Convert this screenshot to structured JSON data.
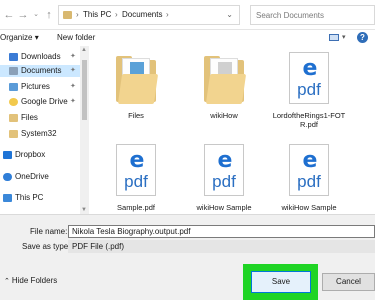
{
  "address_bar": {
    "breadcrumbs": [
      "This PC",
      "Documents"
    ],
    "search_placeholder": "Search Documents"
  },
  "toolbar": {
    "organize_label": "Organize",
    "new_folder_label": "New folder"
  },
  "sidebar": {
    "items": [
      {
        "label": "Downloads",
        "icon": "download-folder-icon",
        "pinned": true
      },
      {
        "label": "Documents",
        "icon": "documents-folder-icon",
        "pinned": true,
        "selected": true
      },
      {
        "label": "Pictures",
        "icon": "pictures-folder-icon",
        "pinned": true
      },
      {
        "label": "Google Drive",
        "icon": "google-drive-icon",
        "pinned": true
      },
      {
        "label": "Files",
        "icon": "folder-icon"
      },
      {
        "label": "System32",
        "icon": "folder-icon"
      },
      {
        "label": "Dropbox",
        "icon": "dropbox-icon"
      },
      {
        "label": "OneDrive",
        "icon": "onedrive-icon"
      },
      {
        "label": "This PC",
        "icon": "computer-icon"
      }
    ]
  },
  "files": [
    {
      "name": "Files",
      "type": "folder"
    },
    {
      "name": "wikiHow",
      "type": "folder"
    },
    {
      "name": "LordoftheRings1-FOTR.pdf",
      "type": "pdf"
    },
    {
      "name": "Sample.pdf",
      "type": "pdf"
    },
    {
      "name": "wikiHow Sample",
      "type": "pdf"
    },
    {
      "name": "wikiHow Sample",
      "type": "pdf"
    }
  ],
  "form": {
    "file_name_label": "File name:",
    "file_name_value": "Nikola Tesla Biography.output.pdf",
    "save_as_type_label": "Save as type",
    "save_as_type_value": "PDF File (.pdf)"
  },
  "footer": {
    "hide_folders_label": "Hide Folders",
    "save_label": "Save",
    "cancel_label": "Cancel"
  },
  "colors": {
    "highlight": "#1fd424",
    "accent": "#0078d7",
    "selected_bg": "#cce8ff"
  }
}
